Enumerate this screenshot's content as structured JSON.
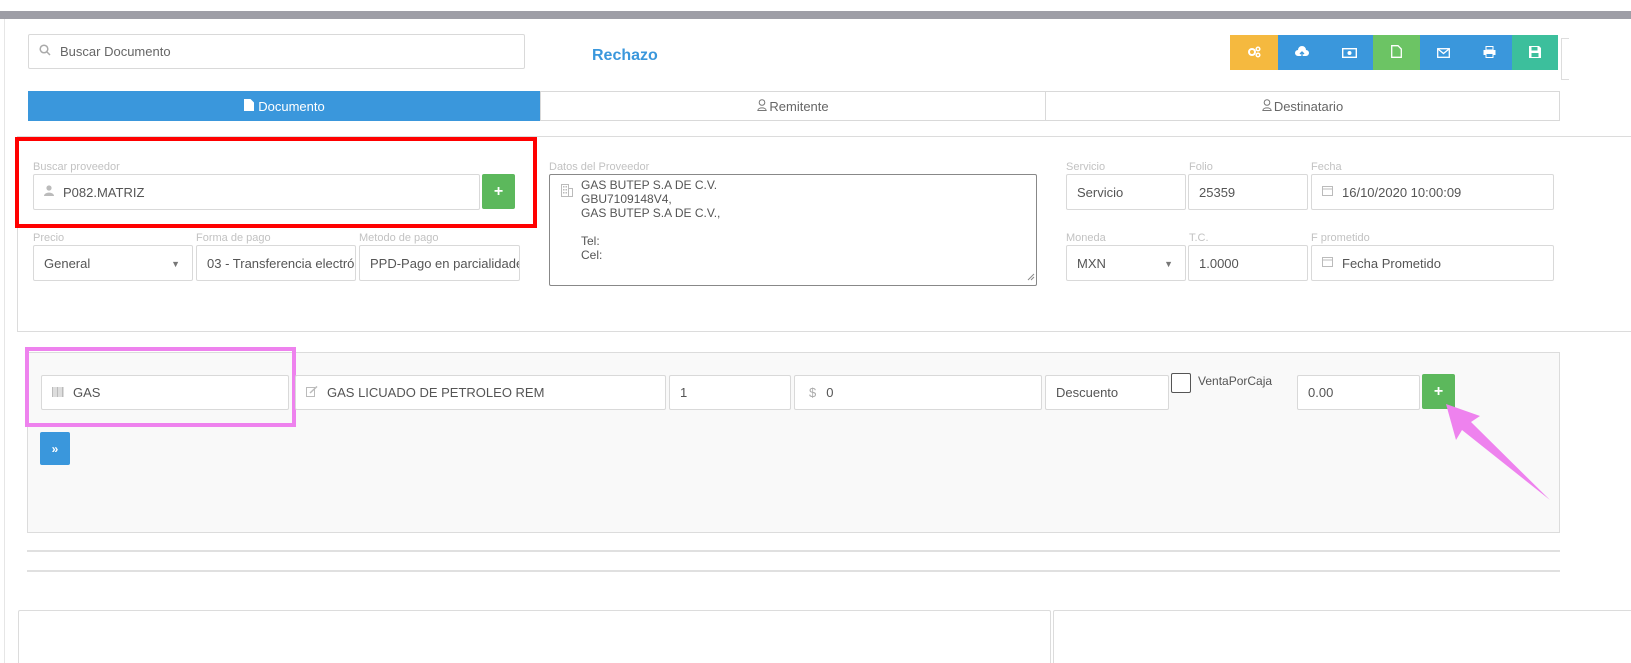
{
  "search": {
    "placeholder": "Buscar Documento"
  },
  "status_text": "Rechazo",
  "toolbar": [
    {
      "icon": "gears-icon",
      "color": "#f5b93f"
    },
    {
      "icon": "cloud-upload-icon",
      "color": "#3a97dc"
    },
    {
      "icon": "money-icon",
      "color": "#3a97dc"
    },
    {
      "icon": "file-icon",
      "color": "#6cc464"
    },
    {
      "icon": "envelope-icon",
      "color": "#3a97dc"
    },
    {
      "icon": "print-icon",
      "color": "#3a97dc"
    },
    {
      "icon": "save-icon",
      "color": "#3cbf9c"
    }
  ],
  "tabs": {
    "documento": "Documento",
    "remitente": "Remitente",
    "destinatario": "Destinatario"
  },
  "form": {
    "proveedor_label": "Buscar proveedor",
    "proveedor_value": "P082.MATRIZ",
    "datos_label": "Datos del Proveedor",
    "datos_lines": [
      "GAS BUTEP S.A DE C.V.",
      "GBU7109148V4,",
      "GAS BUTEP S.A DE C.V.,",
      "",
      "Tel:",
      "Cel:"
    ],
    "servicio_label": "Servicio",
    "servicio_value": "Servicio",
    "folio_label": "Folio",
    "folio_value": "25359",
    "fecha_label": "Fecha",
    "fecha_value": "16/10/2020 10:00:09",
    "precio_label": "Precio",
    "precio_value": "General",
    "forma_pago_label": "Forma de pago",
    "forma_pago_value": "03 - Transferencia electró",
    "metodo_pago_label": "Metodo de pago",
    "metodo_pago_value": "PPD-Pago en parcialidade",
    "moneda_label": "Moneda",
    "moneda_value": "MXN",
    "tc_label": "T.C.",
    "tc_value": "1.0000",
    "fprometido_label": "F prometido",
    "fprometido_placeholder": "Fecha Prometido"
  },
  "product_row": {
    "codigo": "GAS",
    "descripcion": "GAS LICUADO DE PETROLEO REM",
    "cantidad": "1",
    "currency_symbol": "$",
    "precio": "0",
    "descuento_placeholder": "Descuento",
    "venta_por_caja_label": "VentaPorCaja",
    "total": "0.00"
  },
  "colors": {
    "primary": "#3a97dc",
    "success": "#5cb85c",
    "highlight_red": "#ff0000",
    "highlight_pink": "#ee82ee"
  }
}
